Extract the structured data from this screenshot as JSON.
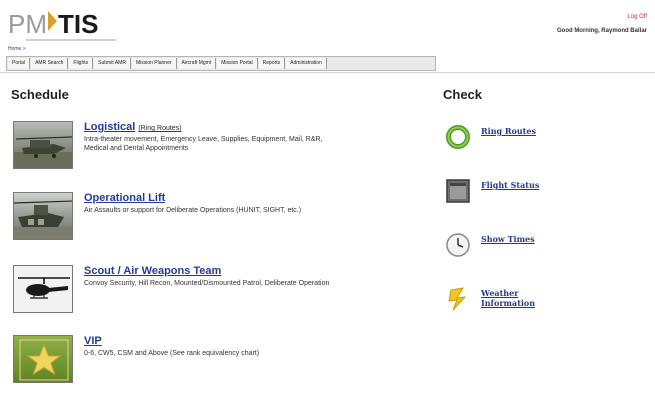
{
  "header": {
    "logo_left": "PM",
    "logo_right": "TIS",
    "logoff": "Log Off",
    "greeting": "Good Morning, Raymond Ballar",
    "home_link": "Home >"
  },
  "nav": [
    {
      "label": "Portal"
    },
    {
      "label": "AMR Search"
    },
    {
      "label": "Flights"
    },
    {
      "label": "Submit AMR"
    },
    {
      "label": "Mission Planner"
    },
    {
      "label": "Aircraft Mgmt"
    },
    {
      "label": "Mission Portal"
    },
    {
      "label": "Reports"
    },
    {
      "label": "Administration"
    }
  ],
  "schedule": {
    "heading": "Schedule",
    "items": [
      {
        "title": "Logistical",
        "subtitle": "(Ring Routes)",
        "description": "Intra-theater movement, Emergency Leave, Supplies, Equipment, Mail, R&R, Medical and Dental Appointments"
      },
      {
        "title": "Operational Lift",
        "subtitle": "",
        "description": "Air Assaults or support for Deliberate Operations (HUNIT, SIGHT, etc.)"
      },
      {
        "title": "Scout / Air Weapons Team",
        "subtitle": "",
        "description": "Convoy Security, Hill Recon, Mounted/Dismounted Patrol, Deliberate Operation"
      },
      {
        "title": "VIP",
        "subtitle": "",
        "description": "0-6, CW5, CSM and Above (See rank equivalency chart)"
      }
    ]
  },
  "check": {
    "heading": "Check",
    "items": [
      {
        "label": "Ring Routes",
        "icon": "ring-icon"
      },
      {
        "label": "Flight Status",
        "icon": "flight-board-icon"
      },
      {
        "label": "Show Times",
        "icon": "clock-icon"
      },
      {
        "label": "Weather Information",
        "icon": "weather-icon"
      }
    ]
  },
  "colors": {
    "link": "#233a9b",
    "accent": "#d9a12a"
  }
}
